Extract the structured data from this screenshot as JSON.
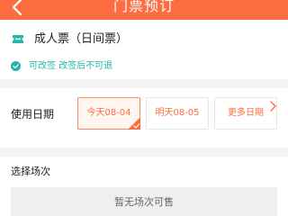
{
  "header": {
    "title": "门票预订"
  },
  "ticket": {
    "name": "成人票（日间票）",
    "policy": "可改签 改签后不可退"
  },
  "date_section": {
    "label": "使用日期",
    "options": [
      {
        "label": "今天08-04",
        "selected": true
      },
      {
        "label": "明天08-05",
        "selected": false
      },
      {
        "label": "更多日期",
        "selected": false
      }
    ]
  },
  "session_section": {
    "label": "选择场次",
    "empty_text": "暂无场次可售"
  },
  "colors": {
    "brand": "#fe6d3f",
    "policy_green": "#23b6a8"
  }
}
